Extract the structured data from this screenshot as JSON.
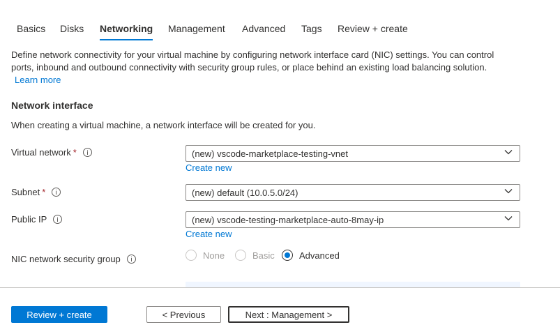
{
  "tabs": [
    {
      "label": "Basics",
      "active": false
    },
    {
      "label": "Disks",
      "active": false
    },
    {
      "label": "Networking",
      "active": true
    },
    {
      "label": "Management",
      "active": false
    },
    {
      "label": "Advanced",
      "active": false
    },
    {
      "label": "Tags",
      "active": false
    },
    {
      "label": "Review + create",
      "active": false
    }
  ],
  "intro": {
    "text": "Define network connectivity for your virtual machine by configuring network interface card (NIC) settings. You can control ports, inbound and outbound connectivity with security group rules, or place behind an existing load balancing solution.",
    "learn_more": "Learn more"
  },
  "network_interface": {
    "title": "Network interface",
    "description": "When creating a virtual machine, a network interface will be created for you."
  },
  "fields": {
    "virtual_network": {
      "label": "Virtual network",
      "required_mark": "*",
      "value": "(new) vscode-marketplace-testing-vnet",
      "create_new": "Create new"
    },
    "subnet": {
      "label": "Subnet",
      "required_mark": "*",
      "value": "(new) default (10.0.5.0/24)"
    },
    "public_ip": {
      "label": "Public IP",
      "value": "(new) vscode-testing-marketplace-auto-8may-ip",
      "create_new": "Create new"
    },
    "nsg": {
      "label": "NIC network security group",
      "options": [
        {
          "label": "None",
          "state": "disabled"
        },
        {
          "label": "Basic",
          "state": "disabled"
        },
        {
          "label": "Advanced",
          "state": "checked"
        }
      ]
    }
  },
  "footer": {
    "review_create": "Review + create",
    "previous": "< Previous",
    "next": "Next : Management >"
  },
  "colors": {
    "accent": "#0078d4",
    "required": "#a4262c",
    "text": "#323130",
    "disabled": "#a19f9d"
  },
  "icons": [
    "info-icon",
    "chevron-down-icon"
  ]
}
